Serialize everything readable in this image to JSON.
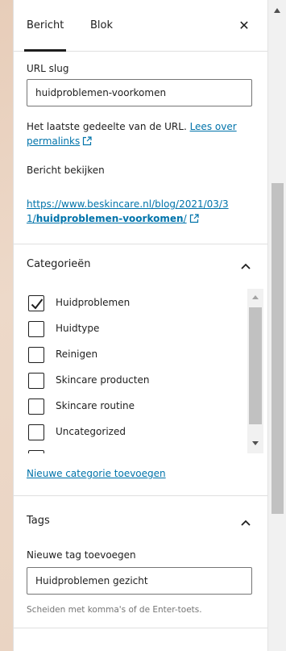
{
  "header": {
    "tab_post": "Bericht",
    "tab_block": "Blok",
    "close_symbol": "✕"
  },
  "url_slug": {
    "label": "URL slug",
    "value": "huidproblemen-voorkomen",
    "help_prefix": "Het laatste gedeelte van de URL. ",
    "help_link_line1": "Lees over",
    "help_link_line2": "permalinks",
    "view_post_label": "Bericht bekijken",
    "post_url_line1": "https://www.beskincare.nl/blog/2021/03/3",
    "post_url_line2_prefix": "1/",
    "post_url_line2_bold": "huidproblemen-voorkomen",
    "post_url_line2_suffix": "/"
  },
  "categories": {
    "title": "Categorieën",
    "items": [
      {
        "label": "Huidproblemen",
        "checked": true
      },
      {
        "label": "Huidtype",
        "checked": false
      },
      {
        "label": "Reinigen",
        "checked": false
      },
      {
        "label": "Skincare producten",
        "checked": false
      },
      {
        "label": "Skincare routine",
        "checked": false
      },
      {
        "label": "Uncategorized",
        "checked": false
      }
    ],
    "add_new_link": "Nieuwe categorie toevoegen"
  },
  "tags": {
    "title": "Tags",
    "new_tag_label": "Nieuwe tag toevoegen",
    "input_value": "Huidproblemen gezicht",
    "help": "Scheiden met komma's of de Enter-toets."
  },
  "colors": {
    "link": "#0073aa",
    "text": "#1e1e1e",
    "border": "#e0e0e0"
  }
}
